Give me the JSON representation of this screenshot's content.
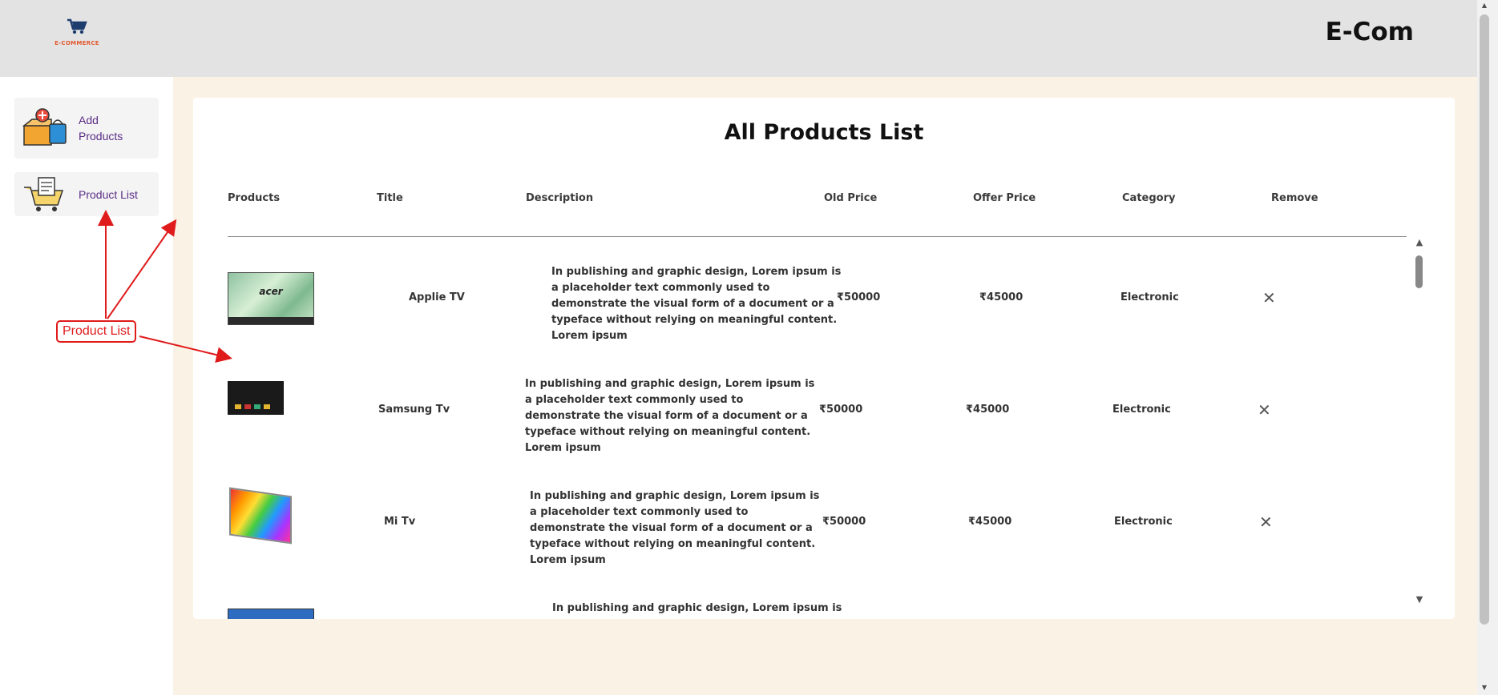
{
  "header": {
    "logo_caption": "E-COMMERCE",
    "brand": "E-Com"
  },
  "sidebar": {
    "items": [
      {
        "label": "Add Products",
        "icon": "add-products-icon"
      },
      {
        "label": "Product List",
        "icon": "product-list-icon"
      }
    ]
  },
  "main": {
    "title": "All Products List",
    "columns": [
      "Products",
      "Title",
      "Description",
      "Old Price",
      "Offer Price",
      "Category",
      "Remove"
    ],
    "products": [
      {
        "title": "Applie TV",
        "description": "In publishing and graphic design, Lorem ipsum is a placeholder text commonly used to demonstrate the visual form of a document or a typeface without relying on meaningful content. Lorem ipsum",
        "old_price": "₹50000",
        "offer_price": "₹45000",
        "category": "Electronic",
        "image": "acer-tv-image"
      },
      {
        "title": "Samsung Tv",
        "description": "In publishing and graphic design, Lorem ipsum is a placeholder text commonly used to demonstrate the visual form of a document or a typeface without relying on meaningful content. Lorem ipsum",
        "old_price": "₹50000",
        "offer_price": "₹45000",
        "category": "Electronic",
        "image": "samsung-tv-image"
      },
      {
        "title": "Mi Tv",
        "description": "In publishing and graphic design, Lorem ipsum is a placeholder text commonly used to demonstrate the visual form of a document or a typeface without relying on meaningful content. Lorem ipsum",
        "old_price": "₹50000",
        "offer_price": "₹45000",
        "category": "Electronic",
        "image": "mi-tv-image"
      },
      {
        "description": "In publishing and graphic design, Lorem ipsum is a",
        "image": "blue-tv-image"
      }
    ]
  },
  "annotation": {
    "label": "Product List",
    "color": "#e01b1b"
  },
  "colors": {
    "header_bg": "#e3e3e3",
    "content_bg": "#fbf2e6",
    "sidebar_label": "#5a2d86"
  }
}
